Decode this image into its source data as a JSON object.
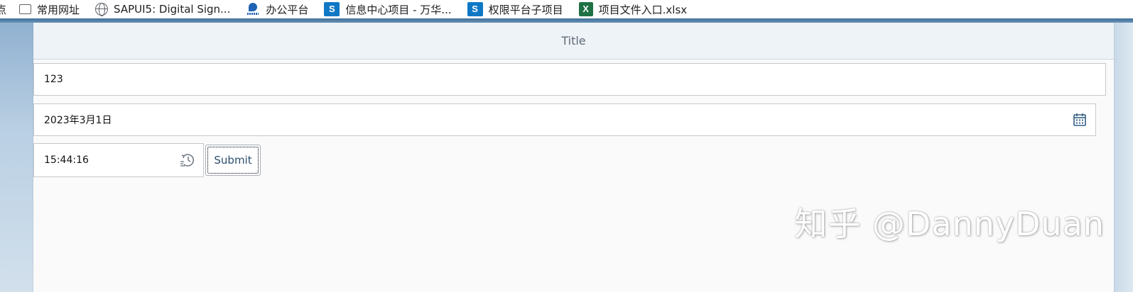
{
  "bookmarks": [
    {
      "label": "点",
      "icon": "none"
    },
    {
      "label": "常用网址",
      "icon": "folder-icon"
    },
    {
      "label": "SAPUI5: Digital Sign...",
      "icon": "globe-icon"
    },
    {
      "label": "办公平台",
      "icon": "portal-logo-icon"
    },
    {
      "label": "信息中心项目 - 万华...",
      "icon": "sharepoint-icon"
    },
    {
      "label": "权限平台子项目",
      "icon": "sharepoint-icon"
    },
    {
      "label": "项目文件入口.xlsx",
      "icon": "excel-icon"
    }
  ],
  "icon_glyphs": {
    "sharepoint": "S",
    "excel": "X"
  },
  "header": {
    "title": "Title"
  },
  "form": {
    "input_value": "123",
    "date_value": "2023年3月1日",
    "time_value": "15:44:16",
    "submit_label": "Submit"
  },
  "watermark": {
    "text": "知乎 @DannyDuan"
  },
  "colors": {
    "header_bg": "#eef3f7",
    "button_text": "#2c4e6c",
    "icon_color": "#346187"
  }
}
